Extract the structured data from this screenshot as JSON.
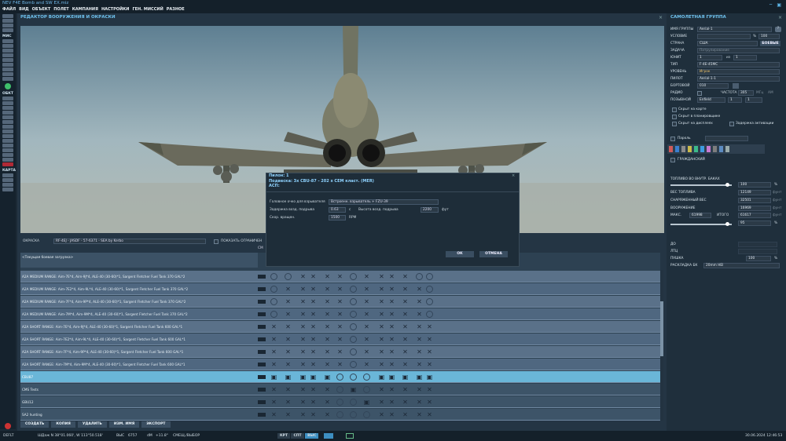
{
  "window_title": "NEV F4E Bomb and SW EX.miz",
  "menu": [
    "ФАЙЛ",
    "ВИД",
    "ОБЪЕКТ",
    "ПОЛЕТ",
    "КАМПАНИЯ",
    "НАСТРОЙКИ",
    "ГЕН. МИССИЙ",
    "РАЗНОЕ"
  ],
  "left_toolbar": {
    "mis": "МИС",
    "obj": "ОБКТ",
    "map": "КАРТА"
  },
  "editor": {
    "title": "РЕДАКТОР ВООРУЖЕНИЯ И ОКРАСКИ",
    "skin_label": "ОКРАСКА",
    "skin_value": "RF-4EJ - JASDF - 57-6371 - SEA by Kerbo",
    "show_limits": "ПОКАЗАТЬ ОГРАНИЧЕН",
    "current_loadout": "<Текущая боевая загрузка>",
    "col_header": "СМ"
  },
  "dialog": {
    "line1": "Пилон: 1",
    "line2": "Подвеска: 3x CBU-87 - 202 x CEM класт. (MER)",
    "line3": "АСП:",
    "fuze_label": "Головное очко для взрывателя",
    "fuze_value": "Встроенн. взрыватель + FZU-39",
    "delay_label": "Задержка возд. подрыва",
    "delay_value": "0.63",
    "delay_unit": "с",
    "height_label": "Высота возд. подрыва",
    "height_value": "2200",
    "height_unit": "фут",
    "rpm_label": "Скор. вращен.",
    "rpm_value": "1500",
    "rpm_unit": "RPM",
    "ok": "ОК",
    "cancel": "ОТМЕНА"
  },
  "loadouts": [
    "A2A MEDIUM RANGE: Aim-7E*4, Aim-9J*4, ALE-40 (30-60)*1, Sargent Fletcher Fuel Tank 370 GAL*2",
    "A2A MEDIUM RANGE: Aim-7E2*4, Aim-9L*4, ALE-40 (30-60)*1, Sargent Fletcher Fuel Tank 370 GAL*2",
    "A2A MEDIUM RANGE: Aim-7F*4, Aim-9P*4, ALE-40 (30-60)*1, Sargent Fletcher Fuel Tank 370 GAL*2",
    "A2A MEDIUM RANGE: Aim-7M*4, Aim-9M*4, ALE-40 (30-60)*1, Sargent Fletcher Fuel Tank 370 GAL*2",
    "A2A SHORT RANGE: Aim-7E*4, Aim-9J*4, ALE-40 (30-60)*1, Sargent Fletcher Fuel Tank 600 GAL*1",
    "A2A SHORT RANGE: Aim-7E2*4, Aim-9L*4, ALE-40 (30-60)*1, Sargent Fletcher Fuel Tank 600 GAL*1",
    "A2A SHORT RANGE: Aim-7F*4, Aim-9P*4, ALE-40 (30-60)*1, Sargent Fletcher Fuel Tank 600 GAL*1",
    "A2A SHORT RANGE: Aim-7M*4, Aim-9M*4, ALE-40 (30-60)*1, Sargent Fletcher Fuel Tank 600 GAL*1",
    "CBU87",
    "CMS Tests",
    "GBU12",
    "SA2 hunting"
  ],
  "bottom_buttons": [
    "СОЗДАТЬ",
    "КОПИЯ",
    "УДАЛИТЬ",
    "ИЗМ. ИМЯ",
    "ЭКСПОРТ"
  ],
  "group": {
    "title": "САМОЛЕТНАЯ ГРУППА",
    "name_label": "ИМЯ ГРУППЫ",
    "name_value": "Aerial-1",
    "cond_label": "УСЛОВИЕ",
    "cond_pct": "%",
    "cond_val": "100",
    "country_label": "СТРАНА",
    "country_value": "США",
    "combat": "БОЕВЫЕ",
    "task_label": "ЗАДАЧА",
    "task_value": "Патрулирование",
    "unit_label": "ЮНИТ",
    "unit_value": "1",
    "unit_of": "из",
    "unit_total": "1",
    "type_label": "ТИП",
    "type_value": "F-4E-45MC",
    "level_label": "УРОВЕНЬ",
    "level_value": "Игрок",
    "pilot_label": "ПИЛОТ",
    "pilot_value": "Aerial-1-1",
    "tail_label": "БОРТОВОЙ",
    "tail_value": "010",
    "radio_label": "РАДИО",
    "freq_label": "ЧАСТОТА",
    "freq_value": "305",
    "freq_unit": "МГц",
    "am": "AM",
    "callsign_label": "ПОЗЫВНОЙ",
    "callsign_value": "Enfield",
    "cs1": "1",
    "cs2": "1",
    "hide_map": "Скрыт на карте",
    "hide_plan": "Скрыт в планировщике",
    "hide_display": "Скрыт на дисплеях",
    "late": "Задержка активации",
    "password": "Пароль",
    "civil": "ГРАЖДАНСКИЙ",
    "fuel_internal": "ТОПЛИВО ВО ВНУТР. БАКАХ",
    "fuel_pct": "100",
    "pct": "%",
    "fuel_weight_label": "ВЕС ТОПЛИВА",
    "fuel_weight": "12149",
    "empty_label": "СНАРЯЖЕННЫЙ ВЕС",
    "empty": "32501",
    "arm_label": "ВООРУЖЕНИЕ",
    "arm": "16969",
    "max_label": "МАКС.",
    "max": "61998",
    "total_label": "ИТОГО",
    "total": "61617",
    "unit_lb": "фунт",
    "slider2": "95",
    "chaff": "ДО",
    "flare": "ЛТЦ",
    "gun_label": "ПУШКА",
    "gun": "100",
    "ammo_label": "РАСКЛАДКА БК",
    "ammo": "20mm HEI"
  },
  "status": {
    "mode": "DEFLT",
    "coords": "ШДаж N 38°01.060', W 113°50.518'",
    "alt_label": "ВЫС",
    "alt": "6757",
    "dm_label": "dM",
    "dm": "+11.8°",
    "sel": "СМЕЩ./ВЫБОР",
    "b1": "КРТ",
    "b2": "СПТ",
    "b3": "ВЫС",
    "datetime": "30.06.2024 12:46:53"
  }
}
